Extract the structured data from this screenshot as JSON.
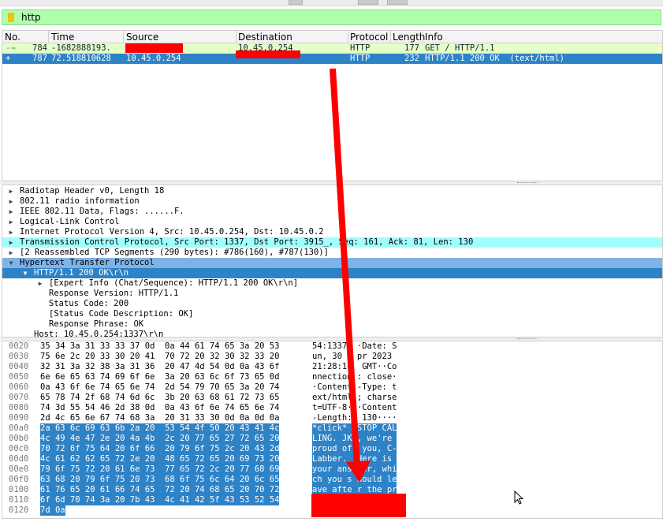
{
  "filter": {
    "value": "http"
  },
  "packet_list": {
    "columns": [
      "No.",
      "Time",
      "Source",
      "Destination",
      "Protocol",
      "Length",
      "Info"
    ],
    "rows": [
      {
        "no": "784",
        "time": "-1682888193.",
        "source": "",
        "destination": "10.45.0.254",
        "protocol": "HTTP",
        "length": "177",
        "info": "GET / HTTP/1.1"
      },
      {
        "no": "787",
        "time": "72.518810628",
        "source": "10.45.0.254",
        "destination": "",
        "protocol": "HTTP",
        "length": "232",
        "info": "HTTP/1.1 200 OK  (text/html)"
      }
    ]
  },
  "details": [
    {
      "text": "Radiotap Header v0, Length 18"
    },
    {
      "text": "802.11 radio information"
    },
    {
      "text": "IEEE 802.11 Data, Flags: ......F."
    },
    {
      "text": "Logical-Link Control"
    },
    {
      "text": "Internet Protocol Version 4, Src: 10.45.0.254, Dst: 10.45.0.2"
    },
    {
      "text": "Transmission Control Protocol, Src Port: 1337, Dst Port: 3915_, Seq: 161, Ack: 81, Len: 130"
    },
    {
      "text": "[2 Reassembled TCP Segments (290 bytes): #786(160), #787(130)]"
    },
    {
      "text": "Hypertext Transfer Protocol"
    },
    {
      "text": "HTTP/1.1 200 OK\\r\\n"
    },
    {
      "text": "[Expert Info (Chat/Sequence): HTTP/1.1 200 OK\\r\\n]"
    },
    {
      "text": "Response Version: HTTP/1.1"
    },
    {
      "text": "Status Code: 200"
    },
    {
      "text": "[Status Code Description: OK]"
    },
    {
      "text": "Response Phrase: OK"
    },
    {
      "text": "Host: 10.45.0.254:1337\\r\\n"
    }
  ],
  "bytes": [
    {
      "offset": "0020",
      "hex": "35 34 3a 31 33 33 37 0d  0a 44 61 74 65 3a 20 53",
      "ascii": "54:1337· ·Date: S"
    },
    {
      "offset": "0030",
      "hex": "75 6e 2c 20 33 30 20 41  70 72 20 32 30 32 33 20",
      "ascii": "un, 30 A pr 2023 "
    },
    {
      "offset": "0040",
      "hex": "32 31 3a 32 38 3a 31 36  20 47 4d 54 0d 0a 43 6f",
      "ascii": "21:28:16  GMT··Co"
    },
    {
      "offset": "0050",
      "hex": "6e 6e 65 63 74 69 6f 6e  3a 20 63 6c 6f 73 65 0d",
      "ascii": "nnection : close·"
    },
    {
      "offset": "0060",
      "hex": "0a 43 6f 6e 74 65 6e 74  2d 54 79 70 65 3a 20 74",
      "ascii": "·Content -Type: t"
    },
    {
      "offset": "0070",
      "hex": "65 78 74 2f 68 74 6d 6c  3b 20 63 68 61 72 73 65",
      "ascii": "ext/html ; charse"
    },
    {
      "offset": "0080",
      "hex": "74 3d 55 54 46 2d 38 0d  0a 43 6f 6e 74 65 6e 74",
      "ascii": "t=UTF-8· ·Content"
    },
    {
      "offset": "0090",
      "hex": "2d 4c 65 6e 67 74 68 3a  20 31 33 30 0d 0a 0d 0a",
      "ascii": "-Length:  130····"
    },
    {
      "offset": "00a0",
      "hex": "2a 63 6c 69 63 6b 2a 20  53 54 4f 50 20 43 41 4c",
      "ascii": "*click*  STOP CAL"
    },
    {
      "offset": "00b0",
      "hex": "4c 49 4e 47 2e 20 4a 4b  2c 20 77 65 27 72 65 20",
      "ascii": "LING. JK , we're "
    },
    {
      "offset": "00c0",
      "hex": "70 72 6f 75 64 20 6f 66  20 79 6f 75 2c 20 43 2d",
      "ascii": "proud of  you, C-"
    },
    {
      "offset": "00d0",
      "hex": "4c 61 62 62 65 72 2e 20  48 65 72 65 20 69 73 20",
      "ascii": "Labber.  Here is "
    },
    {
      "offset": "00e0",
      "hex": "79 6f 75 72 20 61 6e 73  77 65 72 2c 20 77 68 69",
      "ascii": "your ans wer, whi"
    },
    {
      "offset": "00f0",
      "hex": "63 68 20 79 6f 75 20 73  68 6f 75 6c 64 20 6c 65",
      "ascii": "ch you s hould le"
    },
    {
      "offset": "0100",
      "hex": "61 76 65 20 61 66 74 65  72 20 74 68 65 20 70 72",
      "ascii": "ave afte r the pr"
    },
    {
      "offset": "0110",
      "hex": "6f 6d 70 74 3a 20 7b 43  4c 41 42 5f 43 53 52 54",
      "ascii": ""
    },
    {
      "offset": "0120",
      "hex": "7d 0a",
      "ascii": ""
    }
  ],
  "colors": {
    "filter_bg": "#afffaf",
    "selected_bg": "#2e82c6",
    "request_row_bg": "#e4ffc7",
    "tcp_highlight": "#a0ffff",
    "http_highlight": "#7fb3e8",
    "annotation_red": "#ff0000"
  }
}
